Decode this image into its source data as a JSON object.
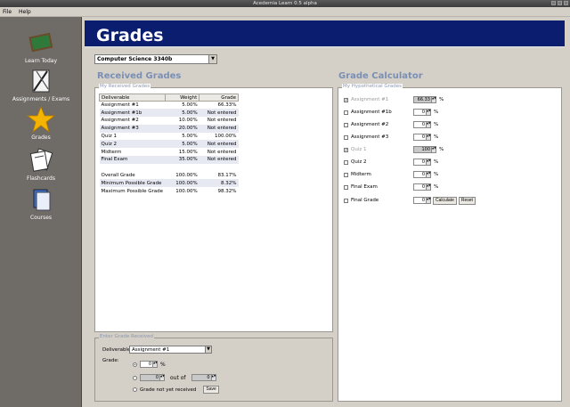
{
  "window": {
    "title": "Acedemia Learn 0.5 alpha"
  },
  "menu": {
    "file": "File",
    "help": "Help"
  },
  "sidebar": {
    "items": [
      {
        "label": "Learn Today",
        "icon": "chalkboard-icon"
      },
      {
        "label": "Assignments / Exams",
        "icon": "drafting-tools-icon"
      },
      {
        "label": "Grades",
        "icon": "star-icon"
      },
      {
        "label": "Flashcards",
        "icon": "flashcards-icon"
      },
      {
        "label": "Courses",
        "icon": "books-icon"
      }
    ]
  },
  "header": {
    "title": "Grades"
  },
  "course_select": {
    "value": "Computer Science 3340b"
  },
  "received": {
    "title": "Received Grades",
    "group_label": "My Received Grades",
    "columns": [
      "Deliverable",
      "Weight",
      "Grade"
    ],
    "rows": [
      [
        "Assignment #1",
        "5.00%",
        "66.33%"
      ],
      [
        "Assignment #1b",
        "5.00%",
        "Not entered"
      ],
      [
        "Assignment #2",
        "10.00%",
        "Not entered"
      ],
      [
        "Assignment #3",
        "20.00%",
        "Not entered"
      ],
      [
        "Quiz 1",
        "5.00%",
        "100.00%"
      ],
      [
        "Quiz 2",
        "5.00%",
        "Not entered"
      ],
      [
        "Midterm",
        "15.00%",
        "Not entered"
      ],
      [
        "Final Exam",
        "35.00%",
        "Not entered"
      ]
    ],
    "summary": [
      [
        "Overall Grade",
        "100.00%",
        "83.17%"
      ],
      [
        "Minimum Possible Grade",
        "100.00%",
        "8.32%"
      ],
      [
        "Maximum Possible Grade",
        "100.00%",
        "98.32%"
      ]
    ]
  },
  "enter": {
    "group_label": "Enter Grade Received",
    "deliverable_label": "Deliverable:",
    "deliverable_value": "Assignment #1",
    "grade_label": "Grade:",
    "percent_value": "0",
    "percent_unit": "%",
    "score_value": "0",
    "out_of_label": "out of",
    "out_of_value": "0",
    "not_received_label": "Grade not yet received",
    "save_label": "Save"
  },
  "calculator": {
    "title": "Grade Calculator",
    "group_label": "My Hypothetical Grades",
    "rows": [
      {
        "label": "Assignment #1",
        "value": "66.33",
        "checked": true,
        "disabled": true,
        "unit": "%"
      },
      {
        "label": "Assignment #1b",
        "value": "0",
        "checked": false,
        "disabled": false,
        "unit": "%"
      },
      {
        "label": "Assignment #2",
        "value": "0",
        "checked": false,
        "disabled": false,
        "unit": "%"
      },
      {
        "label": "Assignment #3",
        "value": "0",
        "checked": false,
        "disabled": false,
        "unit": "%"
      },
      {
        "label": "Quiz 1",
        "value": "100",
        "checked": true,
        "disabled": true,
        "unit": "%"
      },
      {
        "label": "Quiz 2",
        "value": "0",
        "checked": false,
        "disabled": false,
        "unit": "%"
      },
      {
        "label": "Midterm",
        "value": "0",
        "checked": false,
        "disabled": false,
        "unit": "%"
      },
      {
        "label": "Final Exam",
        "value": "0",
        "checked": false,
        "disabled": false,
        "unit": "%"
      },
      {
        "label": "Final Grade",
        "value": "0",
        "checked": false,
        "disabled": false,
        "unit": ""
      }
    ],
    "calculate_label": "Calculate",
    "reset_label": "Reset"
  }
}
